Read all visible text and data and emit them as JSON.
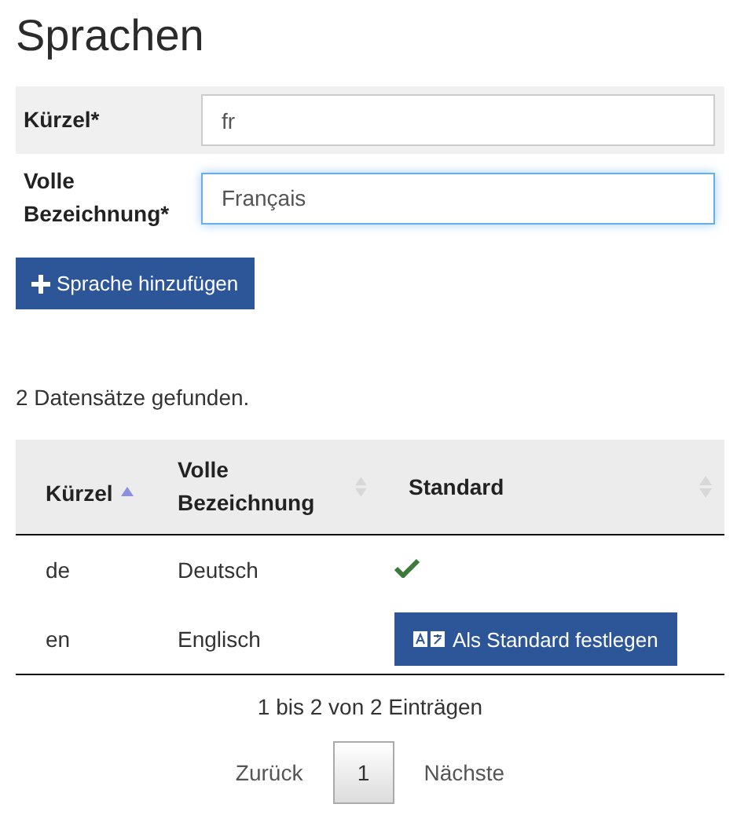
{
  "title": "Sprachen",
  "form": {
    "fields": [
      {
        "label": "Kürzel*",
        "value": "fr",
        "focused": false,
        "shaded": true
      },
      {
        "label": "Volle Bezeichnung*",
        "value": "Français",
        "focused": true,
        "shaded": false
      }
    ],
    "submit": "Sprache hinzufügen"
  },
  "result_count": "2 Datensätze gefunden.",
  "table": {
    "columns": [
      {
        "label": "Kürzel",
        "sorted": true
      },
      {
        "label": "Volle Bezeichnung",
        "sorted": false
      },
      {
        "label": "Standard",
        "sorted": false
      }
    ],
    "rows": [
      {
        "code": "de",
        "name": "Deutsch",
        "is_default": true
      },
      {
        "code": "en",
        "name": "Englisch",
        "is_default": false,
        "action": "Als Standard festlegen"
      }
    ]
  },
  "info": "1 bis 2 von 2 Einträgen",
  "pagination": [
    {
      "label": "Zurück",
      "kind": "link",
      "selected": false
    },
    {
      "label": "1",
      "kind": "page",
      "selected": true
    },
    {
      "label": "Nächste",
      "kind": "link",
      "selected": false
    }
  ]
}
